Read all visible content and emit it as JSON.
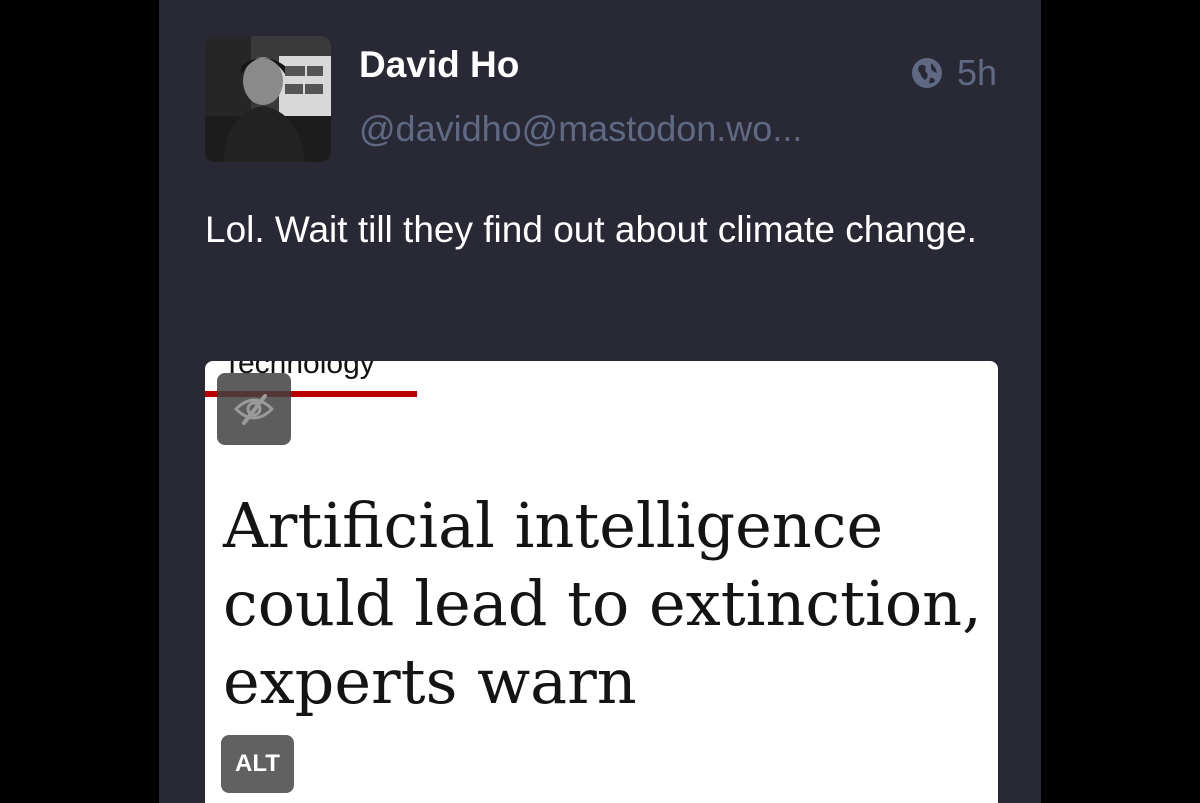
{
  "post": {
    "author_name": "David Ho",
    "author_handle": "@davidho@mastodon.wo...",
    "visibility_icon": "globe-icon",
    "timestamp": "5h",
    "content": "Lol. Wait till they find out about climate change."
  },
  "media": {
    "section_label": "Technology",
    "headline": "Artificial intelligence could lead to extinction, experts warn",
    "hide_icon": "eye-slash-icon",
    "alt_badge": "ALT"
  },
  "colors": {
    "page_background": "#000000",
    "panel_background": "#282935",
    "muted_text": "#606984",
    "primary_text": "#ffffff",
    "accent_red": "#b80000"
  }
}
